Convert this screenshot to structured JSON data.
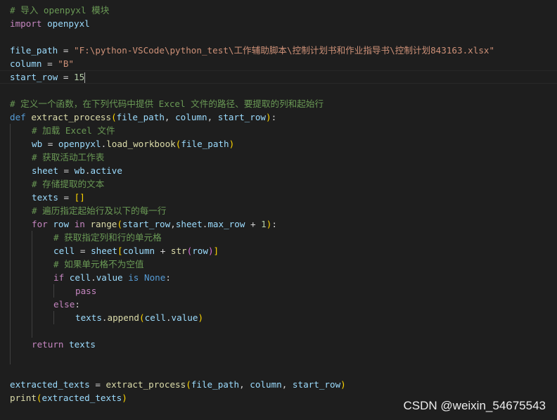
{
  "editor": {
    "lines": [
      {
        "indent": 0,
        "tokens": [
          {
            "t": "# 导入 openpyxl 模块",
            "c": "cm"
          }
        ]
      },
      {
        "indent": 0,
        "tokens": [
          {
            "t": "import",
            "c": "kw"
          },
          {
            "t": " ",
            "c": "pl"
          },
          {
            "t": "openpyxl",
            "c": "vr"
          }
        ]
      },
      {
        "indent": 0,
        "tokens": []
      },
      {
        "indent": 0,
        "tokens": [
          {
            "t": "file_path",
            "c": "vr"
          },
          {
            "t": " = ",
            "c": "pl"
          },
          {
            "t": "\"F:\\python-VSCode\\python_test\\工作辅助脚本\\控制计划书和作业指导书\\控制计划843163.xlsx\"",
            "c": "st"
          }
        ]
      },
      {
        "indent": 0,
        "tokens": [
          {
            "t": "column",
            "c": "vr"
          },
          {
            "t": " = ",
            "c": "pl"
          },
          {
            "t": "\"B\"",
            "c": "st"
          }
        ]
      },
      {
        "indent": 0,
        "cursor": true,
        "tokens": [
          {
            "t": "start_row",
            "c": "vr"
          },
          {
            "t": " = ",
            "c": "pl"
          },
          {
            "t": "15",
            "c": "nm"
          }
        ]
      },
      {
        "indent": 0,
        "tokens": []
      },
      {
        "indent": 0,
        "tokens": [
          {
            "t": "# 定义一个函数，在下列代码中提供 Excel 文件的路径、要提取的列和起始行",
            "c": "cm"
          }
        ]
      },
      {
        "indent": 0,
        "tokens": [
          {
            "t": "def",
            "c": "df"
          },
          {
            "t": " ",
            "c": "pl"
          },
          {
            "t": "extract_process",
            "c": "fn"
          },
          {
            "t": "(",
            "c": "b1"
          },
          {
            "t": "file_path",
            "c": "vr"
          },
          {
            "t": ", ",
            "c": "pl"
          },
          {
            "t": "column",
            "c": "vr"
          },
          {
            "t": ", ",
            "c": "pl"
          },
          {
            "t": "start_row",
            "c": "vr"
          },
          {
            "t": ")",
            "c": "b1"
          },
          {
            "t": ":",
            "c": "pl"
          }
        ]
      },
      {
        "indent": 1,
        "tokens": [
          {
            "t": "# 加载 Excel 文件",
            "c": "cm"
          }
        ]
      },
      {
        "indent": 1,
        "tokens": [
          {
            "t": "wb",
            "c": "vr"
          },
          {
            "t": " = ",
            "c": "pl"
          },
          {
            "t": "openpyxl",
            "c": "vr"
          },
          {
            "t": ".",
            "c": "pl"
          },
          {
            "t": "load_workbook",
            "c": "fn"
          },
          {
            "t": "(",
            "c": "b1"
          },
          {
            "t": "file_path",
            "c": "vr"
          },
          {
            "t": ")",
            "c": "b1"
          }
        ]
      },
      {
        "indent": 1,
        "tokens": [
          {
            "t": "# 获取活动工作表",
            "c": "cm"
          }
        ]
      },
      {
        "indent": 1,
        "tokens": [
          {
            "t": "sheet",
            "c": "vr"
          },
          {
            "t": " = ",
            "c": "pl"
          },
          {
            "t": "wb",
            "c": "vr"
          },
          {
            "t": ".",
            "c": "pl"
          },
          {
            "t": "active",
            "c": "vr"
          }
        ]
      },
      {
        "indent": 1,
        "tokens": [
          {
            "t": "# 存储提取的文本",
            "c": "cm"
          }
        ]
      },
      {
        "indent": 1,
        "tokens": [
          {
            "t": "texts",
            "c": "vr"
          },
          {
            "t": " = ",
            "c": "pl"
          },
          {
            "t": "[]",
            "c": "b1"
          }
        ]
      },
      {
        "indent": 1,
        "tokens": [
          {
            "t": "# 遍历指定起始行及以下的每一行",
            "c": "cm"
          }
        ]
      },
      {
        "indent": 1,
        "tokens": [
          {
            "t": "for",
            "c": "kw"
          },
          {
            "t": " ",
            "c": "pl"
          },
          {
            "t": "row",
            "c": "vr"
          },
          {
            "t": " ",
            "c": "pl"
          },
          {
            "t": "in",
            "c": "kw"
          },
          {
            "t": " ",
            "c": "pl"
          },
          {
            "t": "range",
            "c": "bi"
          },
          {
            "t": "(",
            "c": "b1"
          },
          {
            "t": "start_row",
            "c": "vr"
          },
          {
            "t": ",",
            "c": "pl"
          },
          {
            "t": "sheet",
            "c": "vr"
          },
          {
            "t": ".",
            "c": "pl"
          },
          {
            "t": "max_row",
            "c": "vr"
          },
          {
            "t": " + ",
            "c": "pl"
          },
          {
            "t": "1",
            "c": "nm"
          },
          {
            "t": ")",
            "c": "b1"
          },
          {
            "t": ":",
            "c": "pl"
          }
        ]
      },
      {
        "indent": 2,
        "tokens": [
          {
            "t": "# 获取指定列和行的单元格",
            "c": "cm"
          }
        ]
      },
      {
        "indent": 2,
        "tokens": [
          {
            "t": "cell",
            "c": "vr"
          },
          {
            "t": " = ",
            "c": "pl"
          },
          {
            "t": "sheet",
            "c": "vr"
          },
          {
            "t": "[",
            "c": "b1"
          },
          {
            "t": "column",
            "c": "vr"
          },
          {
            "t": " + ",
            "c": "pl"
          },
          {
            "t": "str",
            "c": "bi"
          },
          {
            "t": "(",
            "c": "b2"
          },
          {
            "t": "row",
            "c": "vr"
          },
          {
            "t": ")",
            "c": "b2"
          },
          {
            "t": "]",
            "c": "b1"
          }
        ]
      },
      {
        "indent": 2,
        "tokens": [
          {
            "t": "# 如果单元格不为空值",
            "c": "cm"
          }
        ]
      },
      {
        "indent": 2,
        "tokens": [
          {
            "t": "if",
            "c": "kw"
          },
          {
            "t": " ",
            "c": "pl"
          },
          {
            "t": "cell",
            "c": "vr"
          },
          {
            "t": ".",
            "c": "pl"
          },
          {
            "t": "value",
            "c": "vr"
          },
          {
            "t": " ",
            "c": "pl"
          },
          {
            "t": "is",
            "c": "df"
          },
          {
            "t": " ",
            "c": "pl"
          },
          {
            "t": "None",
            "c": "cn"
          },
          {
            "t": ":",
            "c": "pl"
          }
        ]
      },
      {
        "indent": 3,
        "tokens": [
          {
            "t": "pass",
            "c": "kw"
          }
        ]
      },
      {
        "indent": 2,
        "tokens": [
          {
            "t": "else",
            "c": "kw"
          },
          {
            "t": ":",
            "c": "pl"
          }
        ]
      },
      {
        "indent": 3,
        "tokens": [
          {
            "t": "texts",
            "c": "vr"
          },
          {
            "t": ".",
            "c": "pl"
          },
          {
            "t": "append",
            "c": "fn"
          },
          {
            "t": "(",
            "c": "b1"
          },
          {
            "t": "cell",
            "c": "vr"
          },
          {
            "t": ".",
            "c": "pl"
          },
          {
            "t": "value",
            "c": "vr"
          },
          {
            "t": ")",
            "c": "b1"
          }
        ]
      },
      {
        "indent": 1,
        "tokens": []
      },
      {
        "indent": 1,
        "tokens": [
          {
            "t": "return",
            "c": "kw"
          },
          {
            "t": " ",
            "c": "pl"
          },
          {
            "t": "texts",
            "c": "vr"
          }
        ]
      },
      {
        "indent": 0,
        "tokens": []
      },
      {
        "indent": 0,
        "tokens": []
      },
      {
        "indent": 0,
        "tokens": [
          {
            "t": "extracted_texts",
            "c": "vr"
          },
          {
            "t": " = ",
            "c": "pl"
          },
          {
            "t": "extract_process",
            "c": "fn"
          },
          {
            "t": "(",
            "c": "b1"
          },
          {
            "t": "file_path",
            "c": "vr"
          },
          {
            "t": ", ",
            "c": "pl"
          },
          {
            "t": "column",
            "c": "vr"
          },
          {
            "t": ", ",
            "c": "pl"
          },
          {
            "t": "start_row",
            "c": "vr"
          },
          {
            "t": ")",
            "c": "b1"
          }
        ]
      },
      {
        "indent": 0,
        "tokens": [
          {
            "t": "print",
            "c": "bi"
          },
          {
            "t": "(",
            "c": "b1"
          },
          {
            "t": "extracted_texts",
            "c": "vr"
          },
          {
            "t": ")",
            "c": "b1"
          }
        ]
      }
    ],
    "indent_guides": [
      {
        "level": 1,
        "from_line": 9,
        "to_line": 26
      },
      {
        "level": 2,
        "from_line": 17,
        "to_line": 24
      },
      {
        "level": 3,
        "from_line": 21,
        "to_line": 21
      },
      {
        "level": 3,
        "from_line": 23,
        "to_line": 23
      }
    ]
  },
  "colors": {
    "background": "#1e1e1e",
    "comment": "#6a9955",
    "keyword": "#c586c0",
    "string": "#ce9178",
    "function": "#dcdcaa",
    "variable": "#9cdcfe",
    "number": "#b5cea8"
  },
  "watermark": {
    "text": "CSDN @weixin_54675543"
  }
}
